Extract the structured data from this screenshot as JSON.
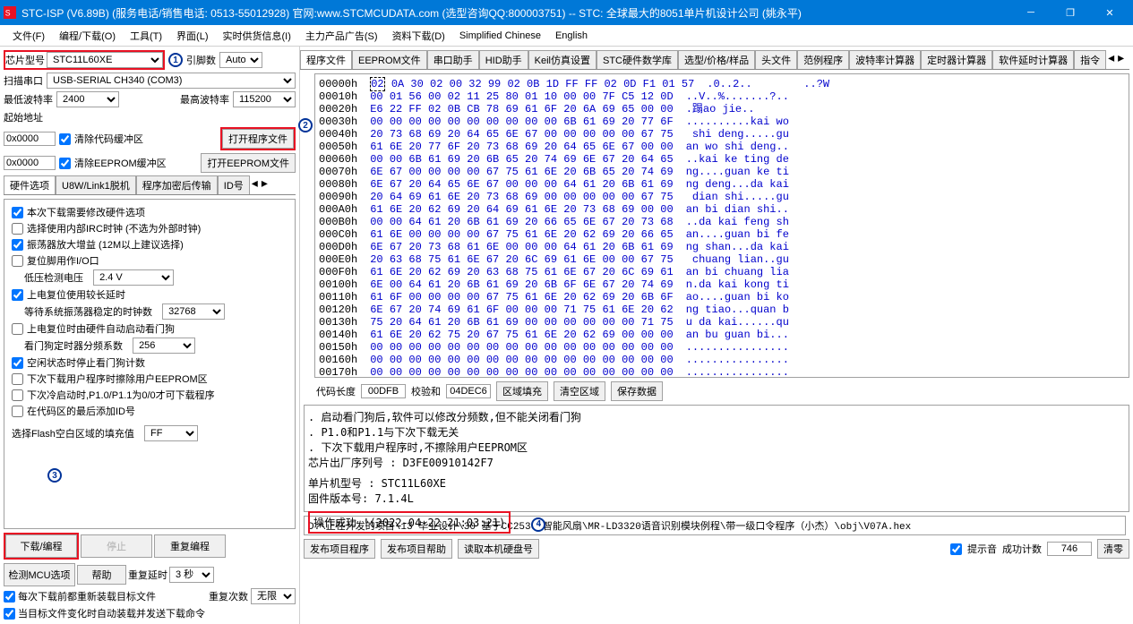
{
  "title": "STC-ISP (V6.89B) (服务电话/销售电话: 0513-55012928) 官网:www.STCMCUDATA.com (选型咨询QQ:800003751) -- STC: 全球最大的8051单片机设计公司 (姚永平)",
  "menu": {
    "file": "文件(F)",
    "program": "编程/下载(O)",
    "tools": "工具(T)",
    "ui": "界面(L)",
    "rt": "实时供货信息(I)",
    "ad": "主力产品广告(S)",
    "dl": "资料下载(D)",
    "sc": "Simplified Chinese",
    "en": "English"
  },
  "left": {
    "chip_label": "芯片型号",
    "chip_value": "STC11L60XE",
    "pin_label": "引脚数",
    "pin_value": "Auto",
    "port_label": "扫描串口",
    "port_value": "USB-SERIAL CH340 (COM3)",
    "min_baud_label": "最低波特率",
    "min_baud": "2400",
    "max_baud_label": "最高波特率",
    "max_baud": "115200",
    "startaddr_label": "起始地址",
    "addr1": "0x0000",
    "clr_code": "清除代码缓冲区",
    "open_code": "打开程序文件",
    "addr2": "0x0000",
    "clr_eep": "清除EEPROM缓冲区",
    "open_eep": "打开EEPROM文件",
    "tabs": {
      "hw": "硬件选项",
      "u8w": "U8W/Link1脱机",
      "enc": "程序加密后传输",
      "id": "ID号"
    },
    "hw": {
      "c1": "本次下载需要修改硬件选项",
      "c2": "选择使用内部IRC时钟 (不选为外部时钟)",
      "c3": "振荡器放大增益 (12M以上建议选择)",
      "c4": "复位脚用作I/O口",
      "c5_lbl": "低压检测电压",
      "c5_val": "2.4 V",
      "c6": "上电复位使用较长延时",
      "c7_lbl": "等待系统振荡器稳定的时钟数",
      "c7_val": "32768",
      "c8": "上电复位时由硬件自动启动看门狗",
      "c9_lbl": "看门狗定时器分频系数",
      "c9_val": "256",
      "c10": "空闲状态时停止看门狗计数",
      "c11": "下次下载用户程序时擦除用户EEPROM区",
      "c12": "下次冷启动时,P1.0/P1.1为0/0才可下载程序",
      "c13": "在代码区的最后添加ID号",
      "flash_lbl": "选择Flash空白区域的填充值",
      "flash_val": "FF"
    },
    "btns": {
      "download": "下载/编程",
      "stop": "停止",
      "reprog": "重复编程",
      "detect": "检测MCU选项",
      "help": "帮助",
      "delay_lbl": "重复延时",
      "delay_val": "3 秒",
      "count_lbl": "重复次数",
      "count_val": "无限"
    },
    "foot_c1": "每次下载前都重新装载目标文件",
    "foot_c2": "当目标文件变化时自动装载并发送下载命令"
  },
  "right": {
    "tabs": [
      "程序文件",
      "EEPROM文件",
      "串口助手",
      "HID助手",
      "Keil仿真设置",
      "STC硬件数学库",
      "选型/价格/样品",
      "头文件",
      "范例程序",
      "波特率计算器",
      "定时器计算器",
      "软件延时计算器",
      "指令"
    ],
    "hex": [
      {
        "a": "00000h",
        "b": "02 0A 30 02 00 32 99 02 0B 1D FF FF 02 0D F1 01 57",
        "t": ".0..2..        ..?W"
      },
      {
        "a": "00010h",
        "b": "00 01 56 00 02 11 25 80 01 10 00 00 7F C5 12 0D",
        "t": "..V..%.......?.."
      },
      {
        "a": "00020h",
        "b": "E6 22 FF 02 0B CB 78 69 61 6F 20 6A 69 65 00 00",
        "t": ".蹋ao jie.."
      },
      {
        "a": "00030h",
        "b": "00 00 00 00 00 00 00 00 00 00 6B 61 69 20 77 6F",
        "t": "..........kai wo"
      },
      {
        "a": "00040h",
        "b": "20 73 68 69 20 64 65 6E 67 00 00 00 00 00 67 75",
        "t": " shi deng.....gu"
      },
      {
        "a": "00050h",
        "b": "61 6E 20 77 6F 20 73 68 69 20 64 65 6E 67 00 00",
        "t": "an wo shi deng.."
      },
      {
        "a": "00060h",
        "b": "00 00 6B 61 69 20 6B 65 20 74 69 6E 67 20 64 65",
        "t": "..kai ke ting de"
      },
      {
        "a": "00070h",
        "b": "6E 67 00 00 00 00 67 75 61 6E 20 6B 65 20 74 69",
        "t": "ng....guan ke ti"
      },
      {
        "a": "00080h",
        "b": "6E 67 20 64 65 6E 67 00 00 00 64 61 20 6B 61 69",
        "t": "ng deng...da kai"
      },
      {
        "a": "00090h",
        "b": "20 64 69 61 6E 20 73 68 69 00 00 00 00 00 67 75",
        "t": " dian shi.....gu"
      },
      {
        "a": "000A0h",
        "b": "61 6E 20 62 69 20 64 69 61 6E 20 73 68 69 00 00",
        "t": "an bi dian shi.."
      },
      {
        "a": "000B0h",
        "b": "00 00 64 61 20 6B 61 69 20 66 65 6E 67 20 73 68",
        "t": "..da kai feng sh"
      },
      {
        "a": "000C0h",
        "b": "61 6E 00 00 00 00 67 75 61 6E 20 62 69 20 66 65",
        "t": "an....guan bi fe"
      },
      {
        "a": "000D0h",
        "b": "6E 67 20 73 68 61 6E 00 00 00 64 61 20 6B 61 69",
        "t": "ng shan...da kai"
      },
      {
        "a": "000E0h",
        "b": "20 63 68 75 61 6E 67 20 6C 69 61 6E 00 00 67 75",
        "t": " chuang lian..gu"
      },
      {
        "a": "000F0h",
        "b": "61 6E 20 62 69 20 63 68 75 61 6E 67 20 6C 69 61",
        "t": "an bi chuang lia"
      },
      {
        "a": "00100h",
        "b": "6E 00 64 61 20 6B 61 69 20 6B 6F 6E 67 20 74 69",
        "t": "n.da kai kong ti"
      },
      {
        "a": "00110h",
        "b": "61 6F 00 00 00 00 67 75 61 6E 20 62 69 20 6B 6F",
        "t": "ao....guan bi ko"
      },
      {
        "a": "00120h",
        "b": "6E 67 20 74 69 61 6F 00 00 00 71 75 61 6E 20 62",
        "t": "ng tiao...quan b"
      },
      {
        "a": "00130h",
        "b": "75 20 64 61 20 6B 61 69 00 00 00 00 00 00 71 75",
        "t": "u da kai......qu"
      },
      {
        "a": "00140h",
        "b": "61 6E 20 62 75 20 67 75 61 6E 20 62 69 00 00 00",
        "t": "an bu guan bi..."
      },
      {
        "a": "00150h",
        "b": "00 00 00 00 00 00 00 00 00 00 00 00 00 00 00 00",
        "t": "................"
      },
      {
        "a": "00160h",
        "b": "00 00 00 00 00 00 00 00 00 00 00 00 00 00 00 00",
        "t": "................"
      },
      {
        "a": "00170h",
        "b": "00 00 00 00 00 00 00 00 00 00 00 00 00 00 00 00",
        "t": "................"
      }
    ],
    "footer": {
      "codelen_lbl": "代码长度",
      "codelen": "00DFB",
      "chk_lbl": "校验和",
      "chk": "04DEC6",
      "fill": "区域填充",
      "clear": "清空区域",
      "save": "保存数据"
    },
    "log": {
      "l1": ".  启动看门狗后,软件可以修改分频数,但不能关闭看门狗",
      "l2": ".  P1.0和P1.1与下次下载无关",
      "l3": ".  下次下载用户程序时,不擦除用户EEPROM区",
      "l4": "芯片出厂序列号 : D3FE00910142F7",
      "l5": "单片机型号 : STC11L60XE",
      "l6": "固件版本号: 7.1.4L",
      "l7": "操作成功 !(2022-04-22 21:03:21)"
    },
    "path": "D:\\正在开发的项目\\13 毕业设计\\30 基于CC2530-智能风扇\\MR-LD3320语音识别模块例程\\带一级口令程序（小杰）\\obj\\V07A.hex",
    "footbtns": {
      "pub": "发布项目程序",
      "pubhelp": "发布项目帮助",
      "readdisk": "读取本机硬盘号",
      "beep": "提示音",
      "okcount_lbl": "成功计数",
      "okcount": "746",
      "clear": "清零"
    }
  }
}
